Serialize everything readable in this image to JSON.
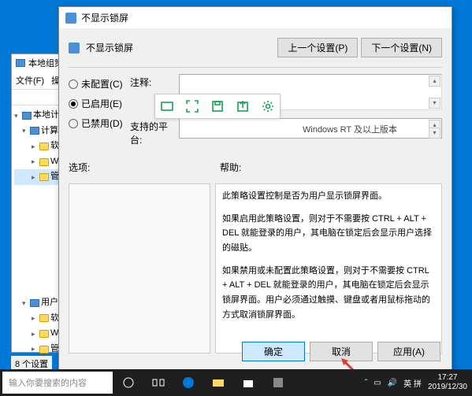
{
  "gpe": {
    "title": "本地组策",
    "menu_file": "文件(F)",
    "menu_action": "操",
    "tree": {
      "root": "本地计算",
      "node1": "计算机",
      "sub1": "软",
      "sub2": "W",
      "sub3": "管",
      "node2": "用户配",
      "sub4": "软",
      "sub5": "W",
      "sub6": "管"
    },
    "status": "8 个设置"
  },
  "dialog": {
    "title": "不显示锁屏",
    "header_label": "不显示锁屏",
    "prev_btn": "上一个设置(P)",
    "next_btn": "下一个设置(N)",
    "radio_unconfigured": "未配置(C)",
    "radio_enabled": "已启用(E)",
    "radio_disabled": "已禁用(D)",
    "comment_label": "注释:",
    "platform_label": "支持的平台:",
    "platform_text": "Windows RT 及以上版本",
    "options_label": "选项:",
    "help_label": "帮助:",
    "help": {
      "p1": "此策略设置控制是否为用户显示锁屏界面。",
      "p2": "如果启用此策略设置，则对于不需要按 CTRL + ALT + DEL 就能登录的用户，其电脑在锁定后会显示用户选择的磁贴。",
      "p3": "如果禁用或未配置此策略设置，则对于不需要按 CTRL + ALT + DEL 就能登录的用户，其电脑在锁定后会显示锁屏界面。用户必须通过触摸、键盘或者用鼠标拖动的方式取消锁屏界面。"
    },
    "ok": "确定",
    "cancel": "取消",
    "apply": "应用(A)"
  },
  "taskbar": {
    "search_placeholder": "输入你要搜索的内容",
    "ime": "英 拼",
    "time": "17:27",
    "date": "2019/12/30"
  }
}
